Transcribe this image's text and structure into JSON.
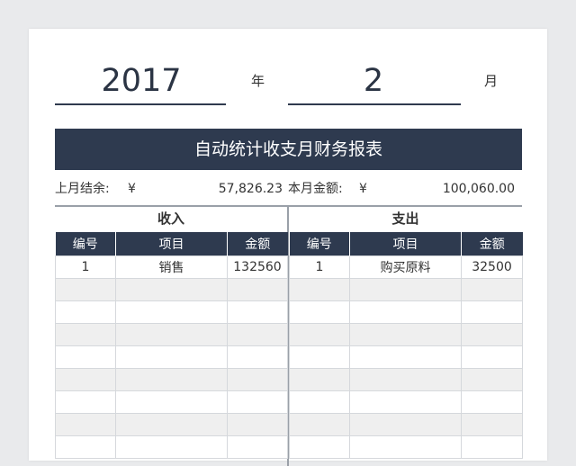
{
  "date": {
    "year": "2017",
    "year_unit": "年",
    "month": "2",
    "month_unit": "月"
  },
  "title": "自动统计收支月财务报表",
  "balance": {
    "last_label": "上月结余:",
    "last_currency": "¥",
    "last_value": "57,826.23",
    "current_label": "本月金额:",
    "current_currency": "¥",
    "current_value": "100,060.00"
  },
  "income": {
    "title": "收入",
    "headers": [
      "编号",
      "项目",
      "金额"
    ],
    "rows": [
      {
        "no": "1",
        "item": "销售",
        "amount": "132560"
      }
    ]
  },
  "expense": {
    "title": "支出",
    "headers": [
      "编号",
      "项目",
      "金额"
    ],
    "rows": [
      {
        "no": "1",
        "item": "购买原料",
        "amount": "32500"
      }
    ]
  },
  "colors": {
    "header_bg": "#2e3a4f",
    "stripe": "#efefef",
    "page_bg": "#e9eaec"
  }
}
